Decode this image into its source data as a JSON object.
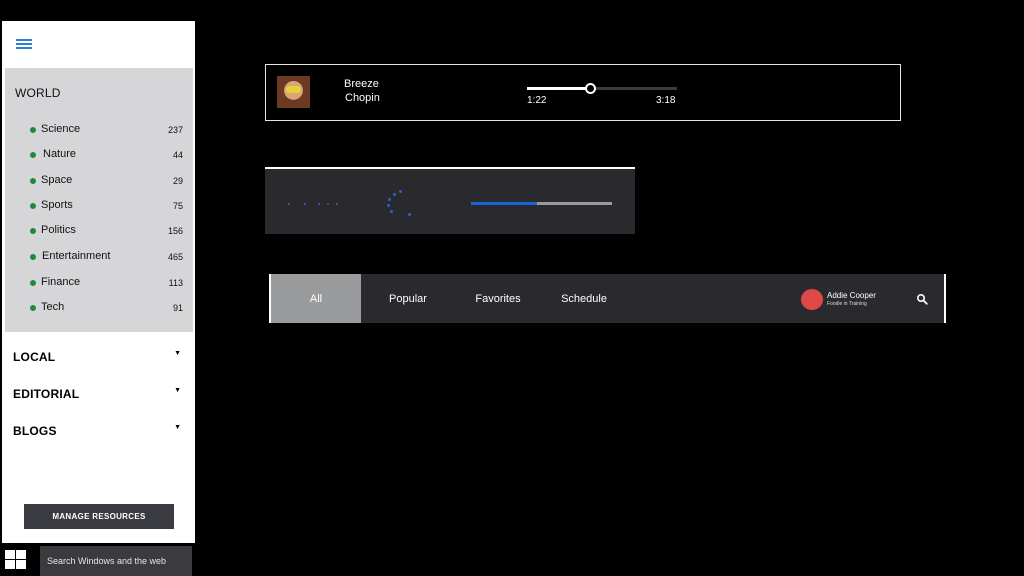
{
  "sidebar": {
    "menu_icon": "hamburger-icon",
    "world": {
      "title": "WORLD",
      "items": [
        {
          "label": "Science",
          "count": "237"
        },
        {
          "label": "Nature",
          "count": "44"
        },
        {
          "label": "Space",
          "count": "29"
        },
        {
          "label": "Sports",
          "count": "75"
        },
        {
          "label": "Politics",
          "count": "156"
        },
        {
          "label": "Entertainment",
          "count": "465"
        },
        {
          "label": "Finance",
          "count": "113"
        },
        {
          "label": "Tech",
          "count": "91"
        }
      ]
    },
    "sections": [
      {
        "label": "LOCAL"
      },
      {
        "label": "EDITORIAL"
      },
      {
        "label": "BLOGS"
      }
    ],
    "caret": "▼",
    "manage_button": "MANAGE RESOURCES"
  },
  "taskbar": {
    "start_icon": "windows-logo-icon",
    "search_placeholder": "Search Windows and the web"
  },
  "player": {
    "title": "Breeze",
    "artist": "Chopin",
    "elapsed": "1:22",
    "total": "3:18",
    "progress_fraction": 0.42
  },
  "loader": {
    "progress_fraction": 0.47,
    "accent": "#1b63d6"
  },
  "pivot": {
    "tabs": [
      "All",
      "Popular",
      "Favorites",
      "Schedule"
    ],
    "active_tab": "All",
    "user_name": "Addie Cooper",
    "user_subtitle": "Foodie in Training",
    "avatar_color": "#e04848",
    "search_icon": "search-icon"
  },
  "colors": {
    "background": "#000000",
    "sidebar_bg": "#ffffff",
    "world_bg": "#d6d6d9",
    "category_dot": "#1e8a3a",
    "accent_blue": "#2f7fd6",
    "panel_bg": "#2a2a2e"
  }
}
